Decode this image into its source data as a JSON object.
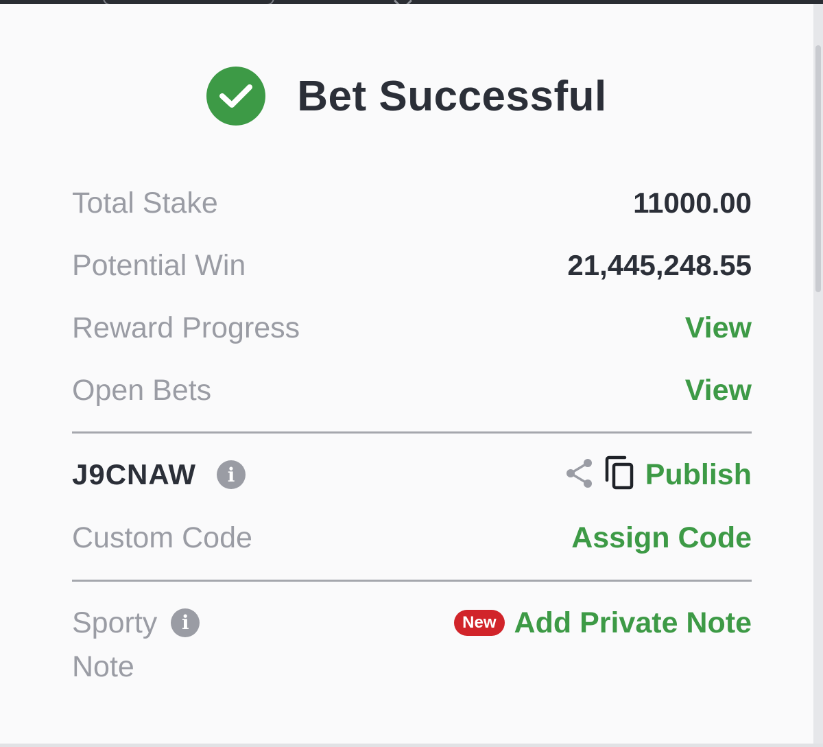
{
  "header": {
    "title": "Bet Successful",
    "success_icon": "check-circle-icon"
  },
  "summary": {
    "total_stake_label": "Total Stake",
    "total_stake_value": "11000.00",
    "potential_win_label": "Potential Win",
    "potential_win_value": "21,445,248.55",
    "reward_progress_label": "Reward Progress",
    "reward_progress_action": "View",
    "open_bets_label": "Open Bets",
    "open_bets_action": "View"
  },
  "booking": {
    "code": "J9CNAW",
    "info_icon": "info-icon",
    "share_icon": "share-icon",
    "copy_icon": "copy-icon",
    "publish_label": "Publish",
    "custom_code_label": "Custom Code",
    "assign_code_label": "Assign Code"
  },
  "note": {
    "label_line1": "Sporty",
    "label_line2": "Note",
    "new_badge": "New",
    "add_note_label": "Add Private Note"
  },
  "colors": {
    "accent_green": "#3d9a46",
    "text_dark": "#2b2f38",
    "text_muted": "#9a9ca4",
    "badge_red": "#d1242a"
  }
}
